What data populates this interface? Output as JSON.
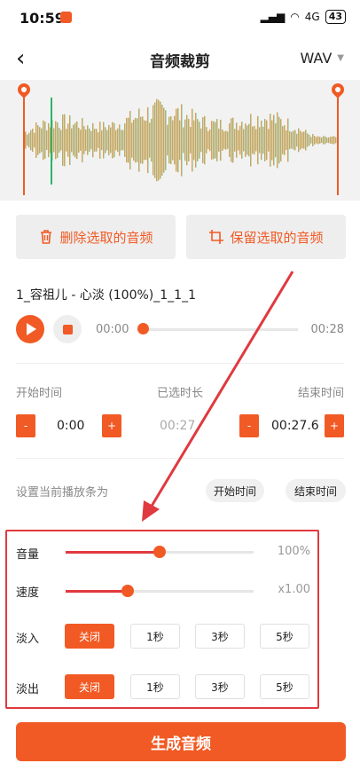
{
  "status": {
    "time": "10:59",
    "network": "4G",
    "battery": "43"
  },
  "header": {
    "title": "音频裁剪",
    "format": "WAV"
  },
  "colors": {
    "accent": "#f15a24",
    "highlight_box": "#e0393f"
  },
  "actions": {
    "delete_label": "删除选取的音频",
    "keep_label": "保留选取的音频"
  },
  "file": {
    "name": "1_容祖儿 - 心淡 (100%)_1_1_1"
  },
  "player": {
    "current": "00:00",
    "total": "00:28",
    "progress": 0
  },
  "timing": {
    "start_label": "开始时间",
    "selected_label": "已选时长",
    "end_label": "结束时间",
    "start_value": "0:00",
    "selected_value": "00:27.",
    "end_value": "00:27.6",
    "minus": "-",
    "plus": "+"
  },
  "set_position": {
    "label": "设置当前播放条为",
    "start_btn": "开始时间",
    "end_btn": "结束时间"
  },
  "volume": {
    "label": "音量",
    "value": "100%",
    "level": 0.5
  },
  "speed": {
    "label": "速度",
    "value": "x1.00",
    "level": 0.33
  },
  "fade_in": {
    "label": "淡入",
    "options": [
      "关闭",
      "1秒",
      "3秒",
      "5秒"
    ],
    "selected": 0
  },
  "fade_out": {
    "label": "淡出",
    "options": [
      "关闭",
      "1秒",
      "3秒",
      "5秒"
    ],
    "selected": 0
  },
  "generate": {
    "label": "生成音频"
  }
}
